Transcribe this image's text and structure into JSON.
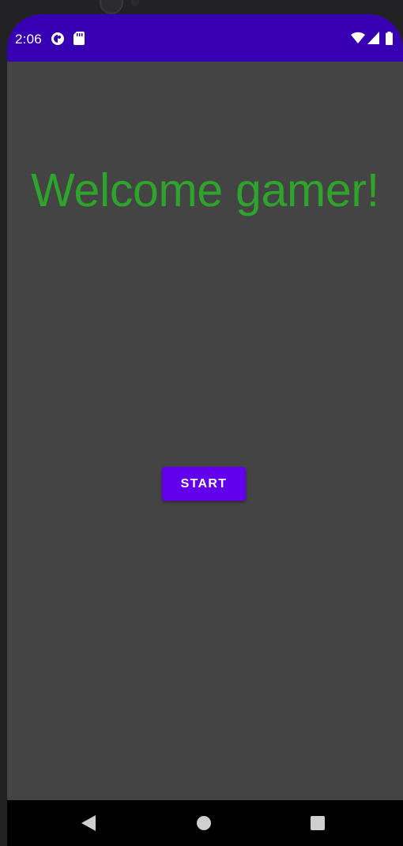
{
  "status_bar": {
    "time": "2:06",
    "left_icons": [
      "privacy-indicator-icon",
      "sd-card-icon"
    ],
    "right_icons": [
      "wifi-icon",
      "cell-signal-icon",
      "battery-icon"
    ],
    "background_color": "#3700b3"
  },
  "main": {
    "welcome_text": "Welcome gamer!",
    "welcome_color": "#2ea42c",
    "start_button_label": "START",
    "start_button_color": "#6200ee",
    "background_color": "#444444"
  },
  "nav_bar": {
    "buttons": [
      "back-icon",
      "home-icon",
      "recents-icon"
    ]
  }
}
